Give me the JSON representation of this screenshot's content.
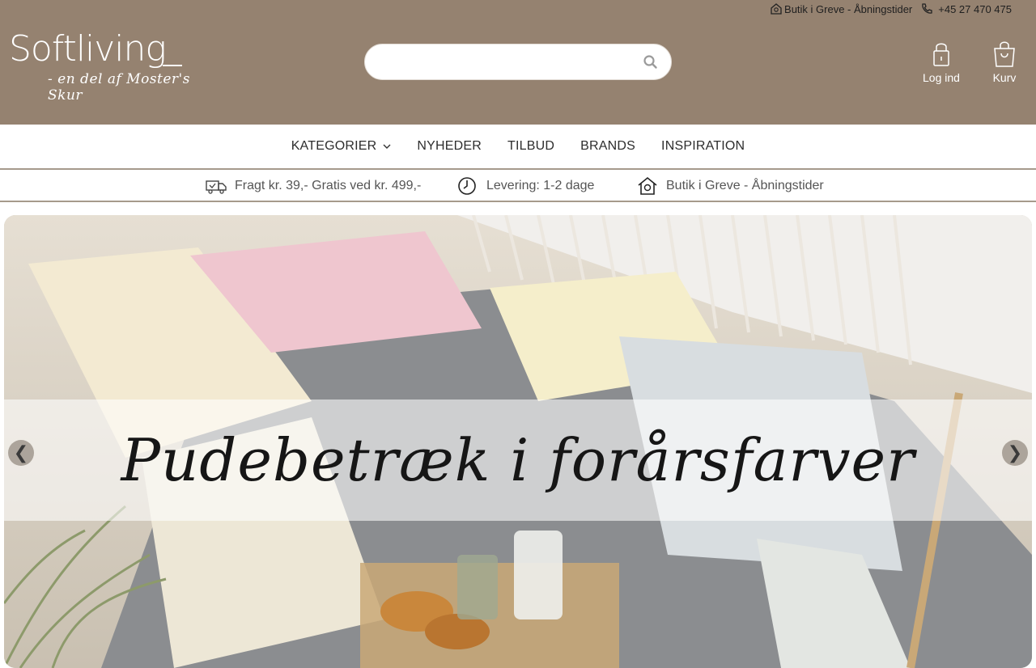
{
  "topbar": {
    "store_link": "Butik i Greve - Åbningstider",
    "phone": "+45 27 470 475"
  },
  "logo": {
    "name": "Softliving",
    "tagline": "- en del af Moster's Skur"
  },
  "search": {
    "placeholder": ""
  },
  "header_actions": {
    "login_label": "Log ind",
    "cart_label": "Kurv"
  },
  "nav": {
    "items": [
      "KATEGORIER",
      "NYHEDER",
      "TILBUD",
      "BRANDS",
      "INSPIRATION"
    ]
  },
  "usp": {
    "shipping": "Fragt kr. 39,- Gratis ved kr. 499,-",
    "delivery": "Levering: 1-2 dage",
    "store": "Butik i Greve - Åbningstider"
  },
  "hero": {
    "headline": "Pudebetræk i forårsfarver",
    "prev": "❮",
    "next": "❯"
  },
  "colors": {
    "header_bg": "#958270",
    "divider": "#a69a8c"
  },
  "icons": [
    "store-icon",
    "phone-icon",
    "search-icon",
    "lock-icon",
    "bag-icon",
    "chevron-down-icon",
    "truck-icon",
    "clock-icon",
    "house-icon"
  ]
}
